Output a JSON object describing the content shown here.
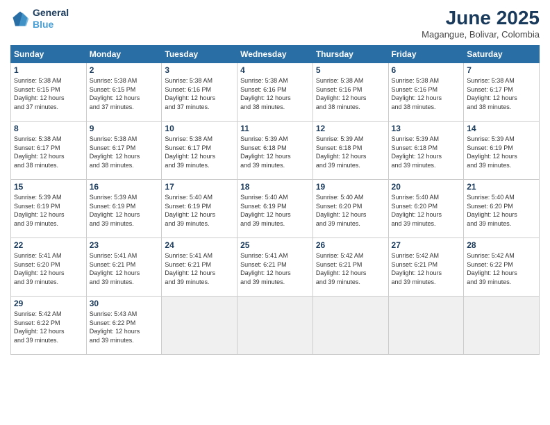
{
  "logo": {
    "line1": "General",
    "line2": "Blue"
  },
  "title": "June 2025",
  "location": "Magangue, Bolivar, Colombia",
  "weekdays": [
    "Sunday",
    "Monday",
    "Tuesday",
    "Wednesday",
    "Thursday",
    "Friday",
    "Saturday"
  ],
  "weeks": [
    [
      {
        "day": "1",
        "info": "Sunrise: 5:38 AM\nSunset: 6:15 PM\nDaylight: 12 hours\nand 37 minutes."
      },
      {
        "day": "2",
        "info": "Sunrise: 5:38 AM\nSunset: 6:15 PM\nDaylight: 12 hours\nand 37 minutes."
      },
      {
        "day": "3",
        "info": "Sunrise: 5:38 AM\nSunset: 6:16 PM\nDaylight: 12 hours\nand 37 minutes."
      },
      {
        "day": "4",
        "info": "Sunrise: 5:38 AM\nSunset: 6:16 PM\nDaylight: 12 hours\nand 38 minutes."
      },
      {
        "day": "5",
        "info": "Sunrise: 5:38 AM\nSunset: 6:16 PM\nDaylight: 12 hours\nand 38 minutes."
      },
      {
        "day": "6",
        "info": "Sunrise: 5:38 AM\nSunset: 6:16 PM\nDaylight: 12 hours\nand 38 minutes."
      },
      {
        "day": "7",
        "info": "Sunrise: 5:38 AM\nSunset: 6:17 PM\nDaylight: 12 hours\nand 38 minutes."
      }
    ],
    [
      {
        "day": "8",
        "info": "Sunrise: 5:38 AM\nSunset: 6:17 PM\nDaylight: 12 hours\nand 38 minutes."
      },
      {
        "day": "9",
        "info": "Sunrise: 5:38 AM\nSunset: 6:17 PM\nDaylight: 12 hours\nand 38 minutes."
      },
      {
        "day": "10",
        "info": "Sunrise: 5:38 AM\nSunset: 6:17 PM\nDaylight: 12 hours\nand 39 minutes."
      },
      {
        "day": "11",
        "info": "Sunrise: 5:39 AM\nSunset: 6:18 PM\nDaylight: 12 hours\nand 39 minutes."
      },
      {
        "day": "12",
        "info": "Sunrise: 5:39 AM\nSunset: 6:18 PM\nDaylight: 12 hours\nand 39 minutes."
      },
      {
        "day": "13",
        "info": "Sunrise: 5:39 AM\nSunset: 6:18 PM\nDaylight: 12 hours\nand 39 minutes."
      },
      {
        "day": "14",
        "info": "Sunrise: 5:39 AM\nSunset: 6:19 PM\nDaylight: 12 hours\nand 39 minutes."
      }
    ],
    [
      {
        "day": "15",
        "info": "Sunrise: 5:39 AM\nSunset: 6:19 PM\nDaylight: 12 hours\nand 39 minutes."
      },
      {
        "day": "16",
        "info": "Sunrise: 5:39 AM\nSunset: 6:19 PM\nDaylight: 12 hours\nand 39 minutes."
      },
      {
        "day": "17",
        "info": "Sunrise: 5:40 AM\nSunset: 6:19 PM\nDaylight: 12 hours\nand 39 minutes."
      },
      {
        "day": "18",
        "info": "Sunrise: 5:40 AM\nSunset: 6:19 PM\nDaylight: 12 hours\nand 39 minutes."
      },
      {
        "day": "19",
        "info": "Sunrise: 5:40 AM\nSunset: 6:20 PM\nDaylight: 12 hours\nand 39 minutes."
      },
      {
        "day": "20",
        "info": "Sunrise: 5:40 AM\nSunset: 6:20 PM\nDaylight: 12 hours\nand 39 minutes."
      },
      {
        "day": "21",
        "info": "Sunrise: 5:40 AM\nSunset: 6:20 PM\nDaylight: 12 hours\nand 39 minutes."
      }
    ],
    [
      {
        "day": "22",
        "info": "Sunrise: 5:41 AM\nSunset: 6:20 PM\nDaylight: 12 hours\nand 39 minutes."
      },
      {
        "day": "23",
        "info": "Sunrise: 5:41 AM\nSunset: 6:21 PM\nDaylight: 12 hours\nand 39 minutes."
      },
      {
        "day": "24",
        "info": "Sunrise: 5:41 AM\nSunset: 6:21 PM\nDaylight: 12 hours\nand 39 minutes."
      },
      {
        "day": "25",
        "info": "Sunrise: 5:41 AM\nSunset: 6:21 PM\nDaylight: 12 hours\nand 39 minutes."
      },
      {
        "day": "26",
        "info": "Sunrise: 5:42 AM\nSunset: 6:21 PM\nDaylight: 12 hours\nand 39 minutes."
      },
      {
        "day": "27",
        "info": "Sunrise: 5:42 AM\nSunset: 6:21 PM\nDaylight: 12 hours\nand 39 minutes."
      },
      {
        "day": "28",
        "info": "Sunrise: 5:42 AM\nSunset: 6:22 PM\nDaylight: 12 hours\nand 39 minutes."
      }
    ],
    [
      {
        "day": "29",
        "info": "Sunrise: 5:42 AM\nSunset: 6:22 PM\nDaylight: 12 hours\nand 39 minutes."
      },
      {
        "day": "30",
        "info": "Sunrise: 5:43 AM\nSunset: 6:22 PM\nDaylight: 12 hours\nand 39 minutes."
      },
      {
        "day": "",
        "info": ""
      },
      {
        "day": "",
        "info": ""
      },
      {
        "day": "",
        "info": ""
      },
      {
        "day": "",
        "info": ""
      },
      {
        "day": "",
        "info": ""
      }
    ]
  ]
}
